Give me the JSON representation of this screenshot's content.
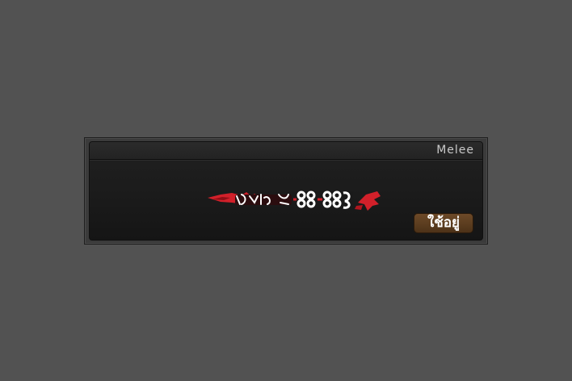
{
  "item": {
    "category": "Melee",
    "equipped_label": "ใช้อยู่",
    "weapon_icon": "red-painted-blade-icon"
  },
  "colors": {
    "background": "#525252",
    "card_frame": "#3b3b3b",
    "card_body": "#1b1b1b",
    "badge": "#5e3f20",
    "weapon_red": "#d2202a"
  }
}
